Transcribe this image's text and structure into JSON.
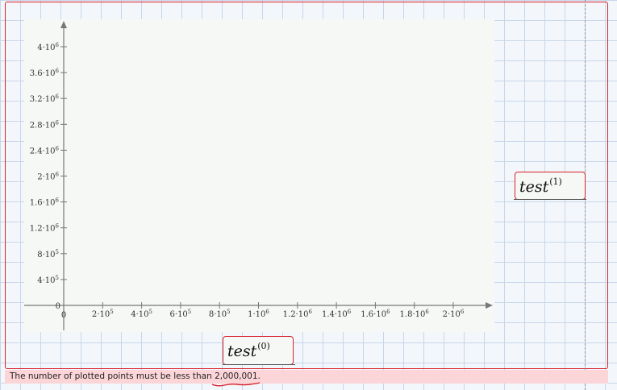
{
  "plot": {
    "x_axis": {
      "origin_label": "0",
      "ticks": [
        {
          "value": 200000,
          "base": "2·10",
          "exp": "5"
        },
        {
          "value": 400000,
          "base": "4·10",
          "exp": "5"
        },
        {
          "value": 600000,
          "base": "6·10",
          "exp": "5"
        },
        {
          "value": 800000,
          "base": "8·10",
          "exp": "5"
        },
        {
          "value": 1000000,
          "base": "1·10",
          "exp": "6"
        },
        {
          "value": 1200000,
          "base": "1.2·10",
          "exp": "6"
        },
        {
          "value": 1400000,
          "base": "1.4·10",
          "exp": "6"
        },
        {
          "value": 1600000,
          "base": "1.6·10",
          "exp": "6"
        },
        {
          "value": 1800000,
          "base": "1.8·10",
          "exp": "6"
        },
        {
          "value": 2000000,
          "base": "2·10",
          "exp": "6"
        }
      ]
    },
    "y_axis": {
      "origin_label": "0",
      "ticks": [
        {
          "value": 400000,
          "base": "4·10",
          "exp": "5"
        },
        {
          "value": 800000,
          "base": "8·10",
          "exp": "5"
        },
        {
          "value": 1200000,
          "base": "1.2·10",
          "exp": "6"
        },
        {
          "value": 1600000,
          "base": "1.6·10",
          "exp": "6"
        },
        {
          "value": 2000000,
          "base": "2·10",
          "exp": "6"
        },
        {
          "value": 2400000,
          "base": "2.4·10",
          "exp": "6"
        },
        {
          "value": 2800000,
          "base": "2.8·10",
          "exp": "6"
        },
        {
          "value": 3200000,
          "base": "3.2·10",
          "exp": "6"
        },
        {
          "value": 3600000,
          "base": "3.6·10",
          "exp": "6"
        },
        {
          "value": 4000000,
          "base": "4·10",
          "exp": "6"
        }
      ]
    },
    "x_expression": {
      "name": "test",
      "index": "(0)"
    },
    "y_expression": {
      "name": "test",
      "index": "(1)"
    }
  },
  "error": {
    "message": "The number of plotted points must be less than ",
    "value": "2,000,001",
    "suffix": "."
  },
  "colors": {
    "error_border": "#d8202b",
    "error_background": "#fcd5d8",
    "grid": "#c9d6ea"
  }
}
